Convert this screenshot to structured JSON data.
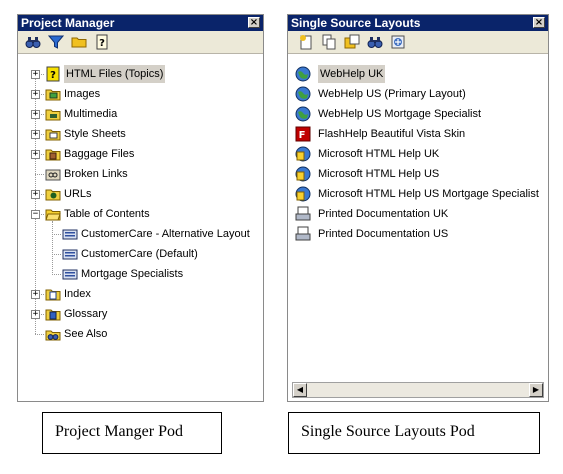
{
  "project_manager": {
    "title": "Project Manager",
    "close_glyph": "×",
    "toolbar": [
      {
        "name": "binoculars-icon",
        "color": "#3a5fb0"
      },
      {
        "name": "filter-icon",
        "color": "#2a6ad0"
      },
      {
        "name": "folder-icon",
        "color": "#f0c020"
      },
      {
        "name": "help-topic-icon",
        "color": "#e0d000"
      }
    ],
    "items": [
      {
        "label": "HTML Files (Topics)",
        "icon": "help-file-icon",
        "expander": "+",
        "level": 0,
        "selected": true
      },
      {
        "label": "Images",
        "icon": "image-folder-icon",
        "expander": "+",
        "level": 0
      },
      {
        "label": "Multimedia",
        "icon": "multimedia-folder-icon",
        "expander": "+",
        "level": 0
      },
      {
        "label": "Style Sheets",
        "icon": "stylesheet-folder-icon",
        "expander": "+",
        "level": 0
      },
      {
        "label": "Baggage Files",
        "icon": "baggage-folder-icon",
        "expander": "+",
        "level": 0
      },
      {
        "label": "Broken Links",
        "icon": "broken-link-icon",
        "expander": "",
        "level": 0
      },
      {
        "label": "URLs",
        "icon": "url-folder-icon",
        "expander": "+",
        "level": 0
      },
      {
        "label": "Table of Contents",
        "icon": "toc-folder-icon",
        "expander": "−",
        "level": 0
      },
      {
        "label": "CustomerCare - Alternative Layout",
        "icon": "toc-book-icon",
        "expander": "",
        "level": 1
      },
      {
        "label": "CustomerCare (Default)",
        "icon": "toc-book-icon",
        "expander": "",
        "level": 1
      },
      {
        "label": "Mortgage Specialists",
        "icon": "toc-book-icon",
        "expander": "",
        "level": 1
      },
      {
        "label": "Index",
        "icon": "index-folder-icon",
        "expander": "+",
        "level": 0
      },
      {
        "label": "Glossary",
        "icon": "glossary-folder-icon",
        "expander": "+",
        "level": 0
      },
      {
        "label": "See Also",
        "icon": "see-also-icon",
        "expander": "",
        "level": 0
      }
    ]
  },
  "single_source": {
    "title": "Single Source Layouts",
    "close_glyph": "×",
    "toolbar": [
      {
        "name": "new-layout-icon",
        "color": "#f0c020"
      },
      {
        "name": "duplicate-layout-icon",
        "color": "#f0c020"
      },
      {
        "name": "generate-icon",
        "color": "#f0c020"
      },
      {
        "name": "view-icon",
        "color": "#3a5fb0"
      },
      {
        "name": "publish-icon",
        "color": "#4070c0"
      }
    ],
    "items": [
      {
        "label": "WebHelp UK",
        "icon": "webhelp-icon",
        "selected": true
      },
      {
        "label": "WebHelp US (Primary Layout)",
        "icon": "webhelp-icon"
      },
      {
        "label": "WebHelp US Mortgage Specialist",
        "icon": "webhelp-icon"
      },
      {
        "label": "FlashHelp Beautiful Vista Skin",
        "icon": "flashhelp-icon"
      },
      {
        "label": "Microsoft HTML Help UK",
        "icon": "html-help-icon"
      },
      {
        "label": "Microsoft HTML Help US",
        "icon": "html-help-icon"
      },
      {
        "label": "Microsoft HTML Help US Mortgage Specialist",
        "icon": "html-help-icon"
      },
      {
        "label": "Printed Documentation UK",
        "icon": "printed-doc-icon"
      },
      {
        "label": "Printed Documentation US",
        "icon": "printed-doc-icon"
      }
    ],
    "scroll_left": "◀",
    "scroll_right": "▶"
  },
  "captions": {
    "left": "Project Manger Pod",
    "right": "Single Source Layouts Pod"
  }
}
